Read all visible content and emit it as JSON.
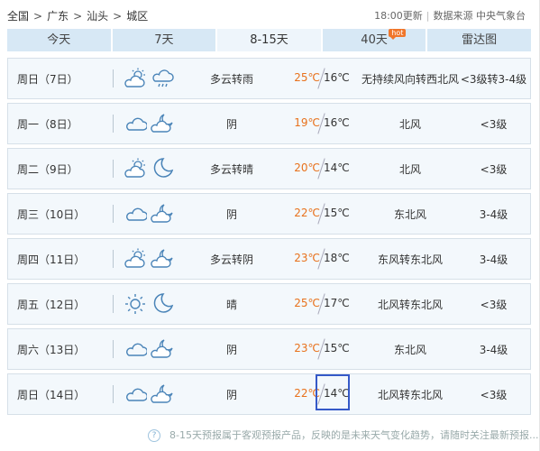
{
  "breadcrumb": {
    "items": [
      "全国",
      "广东",
      "汕头",
      "城区"
    ],
    "separator": ">"
  },
  "meta": {
    "update_time": "18:00更新",
    "divider": "|",
    "source": "数据来源 中央气象台"
  },
  "tabs": [
    {
      "label": "今天",
      "active": false
    },
    {
      "label": "7天",
      "active": false
    },
    {
      "label": "8-15天",
      "active": true
    },
    {
      "label": "40天",
      "active": false,
      "badge": "hot"
    },
    {
      "label": "雷达图",
      "active": false
    }
  ],
  "days": [
    {
      "date": "周日（7日）",
      "icons": [
        "partly-cloudy-icon",
        "cloud-rain-icon"
      ],
      "desc": "多云转雨",
      "high": "25℃",
      "low": "16℃",
      "wind": "无持续风向转西北风",
      "level": "<3级转3-4级"
    },
    {
      "date": "周一（8日）",
      "icons": [
        "cloud-icon",
        "cloud-moon-icon"
      ],
      "desc": "阴",
      "high": "19℃",
      "low": "16℃",
      "wind": "北风",
      "level": "<3级"
    },
    {
      "date": "周二（9日）",
      "icons": [
        "partly-cloudy-icon",
        "moon-icon"
      ],
      "desc": "多云转晴",
      "high": "20℃",
      "low": "14℃",
      "wind": "北风",
      "level": "<3级"
    },
    {
      "date": "周三（10日）",
      "icons": [
        "cloud-icon",
        "cloud-moon-icon"
      ],
      "desc": "阴",
      "high": "22℃",
      "low": "15℃",
      "wind": "东北风",
      "level": "3-4级"
    },
    {
      "date": "周四（11日）",
      "icons": [
        "partly-cloudy-icon",
        "cloud-moon-icon"
      ],
      "desc": "多云转阴",
      "high": "23℃",
      "low": "18℃",
      "wind": "东风转东北风",
      "level": "3-4级"
    },
    {
      "date": "周五（12日）",
      "icons": [
        "sun-icon",
        "moon-icon"
      ],
      "desc": "晴",
      "high": "25℃",
      "low": "17℃",
      "wind": "北风转东北风",
      "level": "<3级"
    },
    {
      "date": "周六（13日）",
      "icons": [
        "cloud-icon",
        "cloud-moon-icon"
      ],
      "desc": "阴",
      "high": "23℃",
      "low": "15℃",
      "wind": "东北风",
      "level": "3-4级"
    },
    {
      "date": "周日（14日）",
      "icons": [
        "cloud-icon",
        "cloud-moon-icon"
      ],
      "desc": "阴",
      "high": "22℃",
      "low": "14℃",
      "wind": "北风转东北风",
      "level": "<3级"
    }
  ],
  "footer": {
    "help_icon": "question-icon",
    "note": "8-15天预报属于客观预报产品，反映的是未来天气变化趋势，请随时关注最新预报......"
  },
  "colors": {
    "high_temp": "#e8711c",
    "tab_bg": "#d7e8f5",
    "row_bg": "#f3f8fc",
    "highlight_box": "#3559c8"
  }
}
